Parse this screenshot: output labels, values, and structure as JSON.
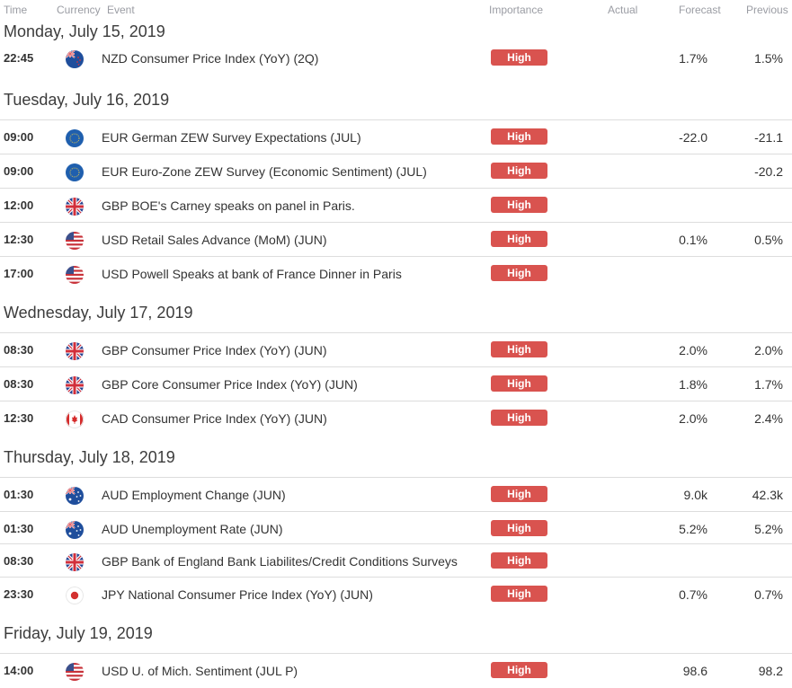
{
  "header": {
    "time": "Time",
    "currency": "Currency",
    "event": "Event",
    "importance": "Importance",
    "actual": "Actual",
    "forecast": "Forecast",
    "previous": "Previous"
  },
  "colors": {
    "importance_high": "#d9534f",
    "header_text": "#9a9ca3",
    "divider": "#dddddd"
  },
  "days": [
    {
      "label": "Monday, July 15, 2019",
      "events": [
        {
          "time": "22:45",
          "flag": "nz-flag-icon",
          "event": "NZD Consumer Price Index (YoY) (2Q)",
          "importance": "High",
          "actual": "",
          "forecast": "1.7%",
          "previous": "1.5%"
        }
      ]
    },
    {
      "label": "Tuesday, July 16, 2019",
      "events": [
        {
          "time": "09:00",
          "flag": "eu-flag-icon",
          "event": "EUR German ZEW Survey Expectations (JUL)",
          "importance": "High",
          "actual": "",
          "forecast": "-22.0",
          "previous": "-21.1"
        },
        {
          "time": "09:00",
          "flag": "eu-flag-icon",
          "event": "EUR Euro-Zone ZEW Survey (Economic Sentiment) (JUL)",
          "importance": "High",
          "actual": "",
          "forecast": "",
          "previous": "-20.2"
        },
        {
          "time": "12:00",
          "flag": "uk-flag-icon",
          "event": "GBP BOE's Carney speaks on panel in Paris.",
          "importance": "High",
          "actual": "",
          "forecast": "",
          "previous": ""
        },
        {
          "time": "12:30",
          "flag": "us-flag-icon",
          "event": "USD Retail Sales Advance (MoM) (JUN)",
          "importance": "High",
          "actual": "",
          "forecast": "0.1%",
          "previous": "0.5%"
        },
        {
          "time": "17:00",
          "flag": "us-flag-icon",
          "event": "USD Powell Speaks at bank of France Dinner in Paris",
          "importance": "High",
          "actual": "",
          "forecast": "",
          "previous": ""
        }
      ]
    },
    {
      "label": "Wednesday, July 17, 2019",
      "events": [
        {
          "time": "08:30",
          "flag": "uk-flag-icon",
          "event": "GBP Consumer Price Index (YoY) (JUN)",
          "importance": "High",
          "actual": "",
          "forecast": "2.0%",
          "previous": "2.0%"
        },
        {
          "time": "08:30",
          "flag": "uk-flag-icon",
          "event": "GBP Core Consumer Price Index (YoY) (JUN)",
          "importance": "High",
          "actual": "",
          "forecast": "1.8%",
          "previous": "1.7%"
        },
        {
          "time": "12:30",
          "flag": "ca-flag-icon",
          "event": "CAD Consumer Price Index (YoY) (JUN)",
          "importance": "High",
          "actual": "",
          "forecast": "2.0%",
          "previous": "2.4%"
        }
      ]
    },
    {
      "label": "Thursday, July 18, 2019",
      "events": [
        {
          "time": "01:30",
          "flag": "au-flag-icon",
          "event": "AUD Employment Change (JUN)",
          "importance": "High",
          "actual": "",
          "forecast": "9.0k",
          "previous": "42.3k"
        },
        {
          "time": "01:30",
          "flag": "au-flag-icon",
          "event": "AUD Unemployment Rate (JUN)",
          "importance": "High",
          "actual": "",
          "forecast": "5.2%",
          "previous": "5.2%"
        },
        {
          "time": "08:30",
          "flag": "uk-flag-icon",
          "event": "GBP Bank of England Bank Liabilites/Credit Conditions Surveys",
          "importance": "High",
          "actual": "",
          "forecast": "",
          "previous": ""
        },
        {
          "time": "23:30",
          "flag": "jp-flag-icon",
          "event": "JPY National Consumer Price Index (YoY) (JUN)",
          "importance": "High",
          "actual": "",
          "forecast": "0.7%",
          "previous": "0.7%"
        }
      ]
    },
    {
      "label": "Friday, July 19, 2019",
      "events": [
        {
          "time": "14:00",
          "flag": "us-flag-icon",
          "event": "USD U. of Mich. Sentiment (JUL P)",
          "importance": "High",
          "actual": "",
          "forecast": "98.6",
          "previous": "98.2"
        }
      ]
    }
  ]
}
